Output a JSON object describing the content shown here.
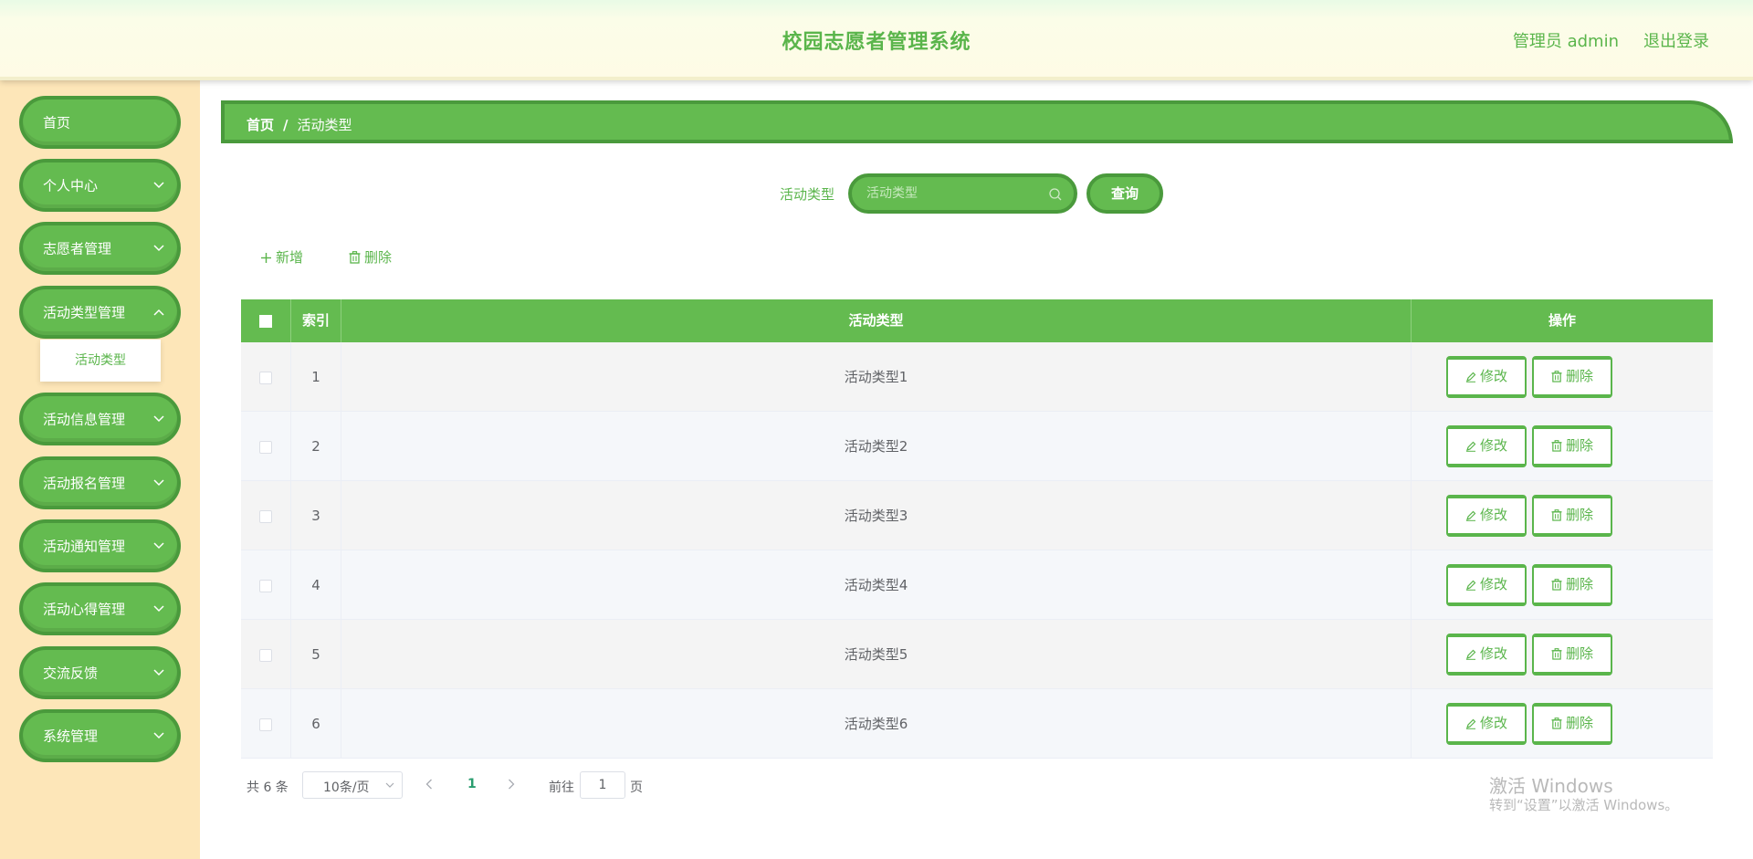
{
  "header": {
    "title": "校园志愿者管理系统",
    "user": "管理员 admin",
    "logout": "退出登录"
  },
  "sidebar": {
    "items": [
      {
        "label": "首页"
      },
      {
        "label": "个人中心"
      },
      {
        "label": "志愿者管理"
      },
      {
        "label": "活动类型管理"
      },
      {
        "label": "活动信息管理"
      },
      {
        "label": "活动报名管理"
      },
      {
        "label": "活动通知管理"
      },
      {
        "label": "活动心得管理"
      },
      {
        "label": "交流反馈"
      },
      {
        "label": "系统管理"
      }
    ],
    "submenu": {
      "label": "活动类型"
    }
  },
  "breadcrumb": {
    "home": "首页",
    "separator": "/",
    "current": "活动类型"
  },
  "search": {
    "label": "活动类型",
    "placeholder": "活动类型",
    "button": "查询"
  },
  "actions": {
    "add": "新增",
    "delete": "删除"
  },
  "table": {
    "headers": {
      "index": "索引",
      "type": "活动类型",
      "ops": "操作"
    },
    "edit_label": "修改",
    "delete_label": "删除",
    "rows": [
      {
        "index": "1",
        "type": "活动类型1"
      },
      {
        "index": "2",
        "type": "活动类型2"
      },
      {
        "index": "3",
        "type": "活动类型3"
      },
      {
        "index": "4",
        "type": "活动类型4"
      },
      {
        "index": "5",
        "type": "活动类型5"
      },
      {
        "index": "6",
        "type": "活动类型6"
      }
    ]
  },
  "pagination": {
    "total": "共 6 条",
    "page_size": "10条/页",
    "current_page": "1",
    "goto_label": "前往",
    "goto_value": "1",
    "page_unit": "页"
  },
  "watermark": {
    "line1": "激活 Windows",
    "line2": "转到“设置”以激活 Windows。"
  },
  "colors": {
    "primary": "#64bb50",
    "primary_dark": "#4a9a3c",
    "sidebar_bg": "#fde6b8",
    "text_green": "#5ab54b"
  }
}
